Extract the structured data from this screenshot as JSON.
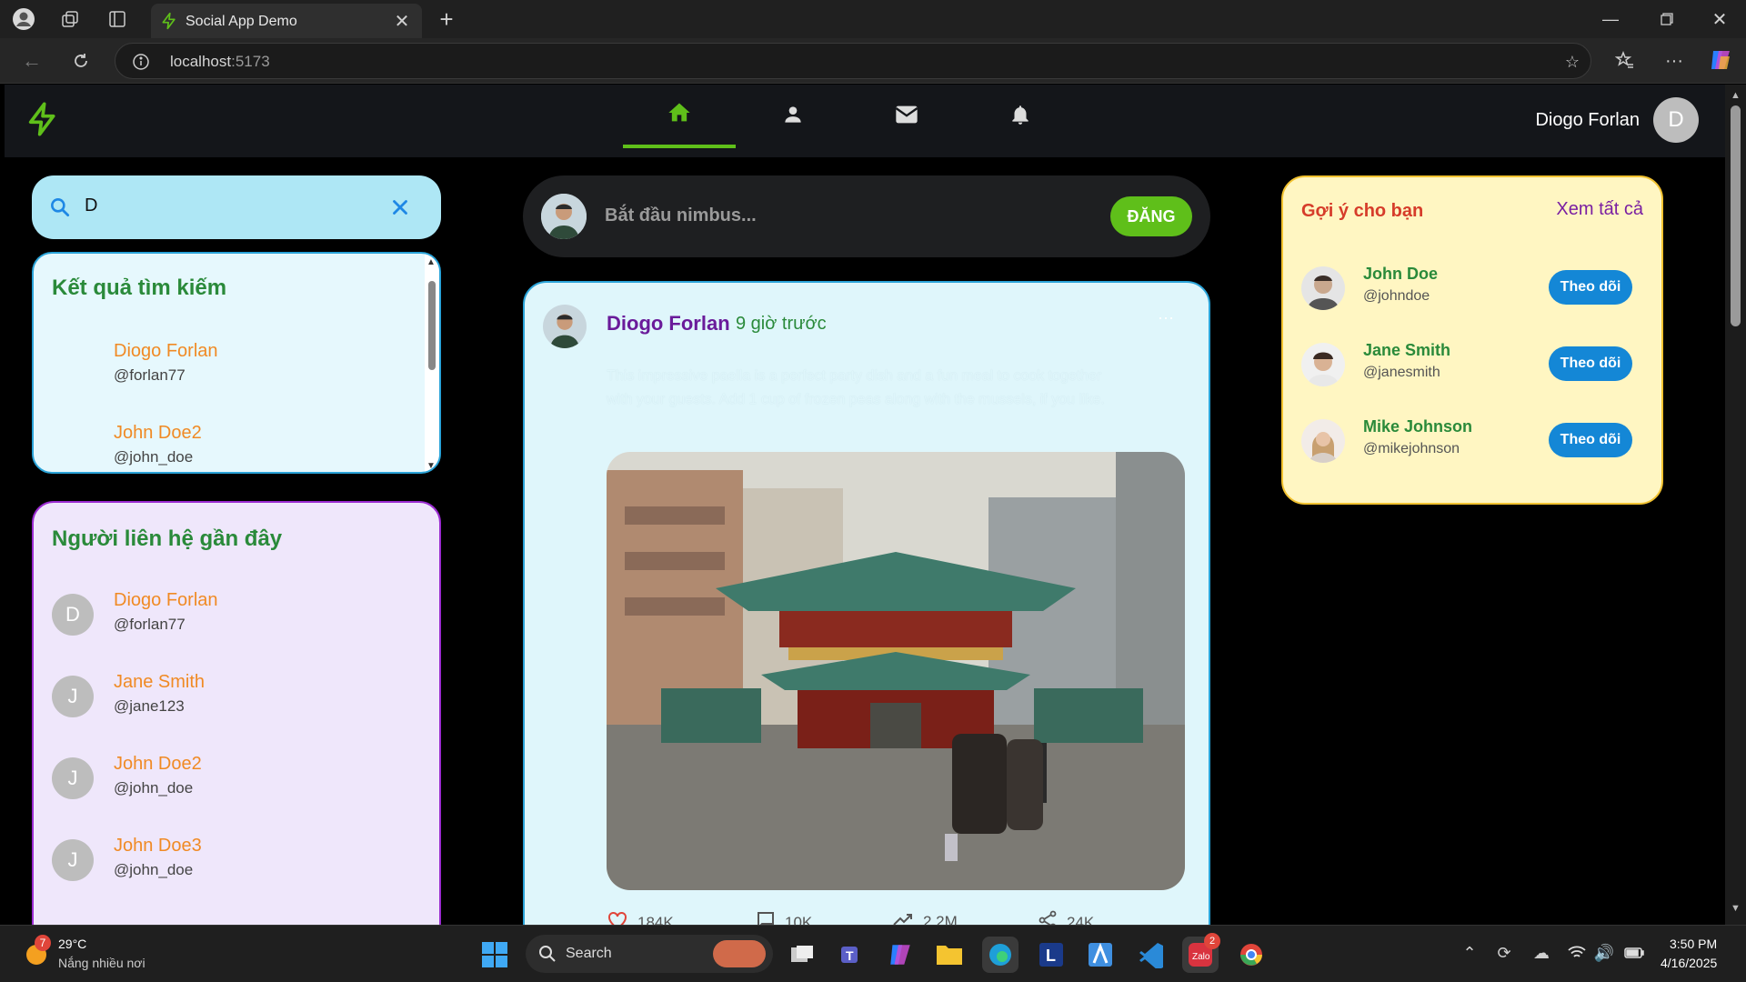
{
  "browser": {
    "tab_title": "Social App Demo",
    "url_host": "localhost",
    "url_port": ":5173"
  },
  "app": {
    "brand_color": "#5fbf1a",
    "nav": [
      "home-icon",
      "profile-icon",
      "mail-icon",
      "bell-icon"
    ],
    "user_name": "Diogo Forlan",
    "user_initial": "D"
  },
  "search": {
    "value": "D"
  },
  "search_results": {
    "title": "Kết quả tìm kiếm",
    "items": [
      {
        "name": "Diogo Forlan",
        "handle": "@forlan77"
      },
      {
        "name": "John Doe2",
        "handle": "@john_doe"
      }
    ]
  },
  "recent_contacts": {
    "title": "Người liên hệ gần đây",
    "items": [
      {
        "initial": "D",
        "name": "Diogo Forlan",
        "handle": "@forlan77"
      },
      {
        "initial": "J",
        "name": "Jane Smith",
        "handle": "@jane123"
      },
      {
        "initial": "J",
        "name": "John Doe2",
        "handle": "@john_doe"
      },
      {
        "initial": "J",
        "name": "John Doe3",
        "handle": "@john_doe"
      }
    ]
  },
  "composer": {
    "placeholder": "Bắt đầu nimbus...",
    "post_label": "ĐĂNG"
  },
  "post": {
    "author": "Diogo Forlan",
    "time": "9 giờ trước",
    "text": "This impressive paella is a perfect party dish and a fun meal to cook together with your guests. Add 1 cup of frozen peas along with the mussels, if you like.",
    "stats": {
      "likes": "184K",
      "comments": "10K",
      "views": "2.2M",
      "shares": "24K"
    }
  },
  "suggestions": {
    "title": "Gợi ý cho bạn",
    "see_all": "Xem tất cả",
    "follow_label": "Theo dõi",
    "items": [
      {
        "name": "John Doe",
        "handle": "@johndoe"
      },
      {
        "name": "Jane Smith",
        "handle": "@janesmith"
      },
      {
        "name": "Mike Johnson",
        "handle": "@mikejohnson"
      }
    ]
  },
  "taskbar": {
    "weather_temp": "29°C",
    "weather_desc": "Nắng nhiều nơi",
    "weather_badge": "7",
    "search_label": "Search",
    "zalo_badge": "2",
    "time": "3:50 PM",
    "date": "4/16/2025"
  }
}
